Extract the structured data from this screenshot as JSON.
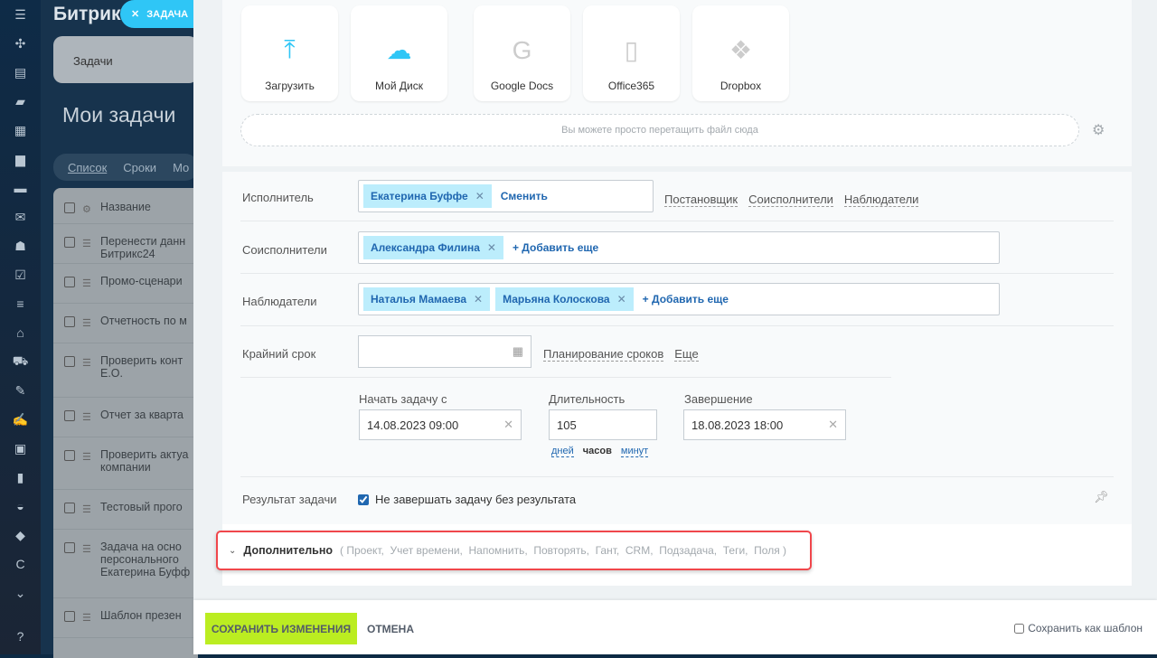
{
  "background": {
    "logo": "Битрикс",
    "tag": "ЗАДАЧА",
    "tabs": "Задачи",
    "title": "Мои задачи",
    "views": [
      "Список",
      "Сроки",
      "Мо"
    ],
    "column": "Название",
    "rows": [
      "Перенести данн Битрикс24",
      "Промо-сценари",
      "Отчетность по м",
      "Проверить конт Е.О.",
      "Отчет за кварта",
      "Проверить актуа компании",
      "Тестовый прого",
      "Задача на осно персонального Екатерина Буфф",
      "Шаблон презен"
    ]
  },
  "files": {
    "buttons": [
      {
        "label": "Загрузить",
        "icon": "upload-icon"
      },
      {
        "label": "Мой Диск",
        "icon": "disk-24-icon"
      },
      {
        "label": "Google Docs",
        "icon": "google-icon"
      },
      {
        "label": "Office365",
        "icon": "office-icon"
      },
      {
        "label": "Dropbox",
        "icon": "dropbox-icon"
      }
    ],
    "drop_hint": "Вы можете просто перетащить файл сюда"
  },
  "assignee": {
    "label": "Исполнитель",
    "chip": "Екатерина Буффе",
    "change": "Сменить",
    "links": [
      "Постановщик",
      "Соисполнители",
      "Наблюдатели"
    ]
  },
  "coassignees": {
    "label": "Соисполнители",
    "chips": [
      "Александра Филина"
    ],
    "add": "+ Добавить еще"
  },
  "observers": {
    "label": "Наблюдатели",
    "chips": [
      "Наталья Мамаева",
      "Марьяна Колоскова"
    ],
    "add": "+ Добавить еще"
  },
  "deadline": {
    "label": "Крайний срок",
    "value": "",
    "links": [
      "Планирование сроков",
      "Еще"
    ]
  },
  "schedule": {
    "start_label": "Начать задачу с",
    "start": "14.08.2023 09:00",
    "duration_label": "Длительность",
    "duration": "105",
    "units": [
      "дней",
      "часов",
      "минут"
    ],
    "end_label": "Завершение",
    "end": "18.08.2023 18:00"
  },
  "result": {
    "label": "Результат задачи",
    "checkbox": "Не завершать задачу без результата",
    "checked": true
  },
  "more": {
    "label": "Дополнительно",
    "items": "( Проект,  Учет времени,  Напомнить,  Повторять,  Гант,  CRM,  Подзадача,  Теги,  Поля )",
    "highlight": "#f0464b"
  },
  "footer": {
    "save": "СОХРАНИТЬ ИЗМЕНЕНИЯ",
    "cancel": "ОТМЕНА",
    "template": "Сохранить как шаблон"
  },
  "colors": {
    "accent": "#2fc6f6",
    "save": "#bbed21",
    "chip": "#bcedfc"
  }
}
